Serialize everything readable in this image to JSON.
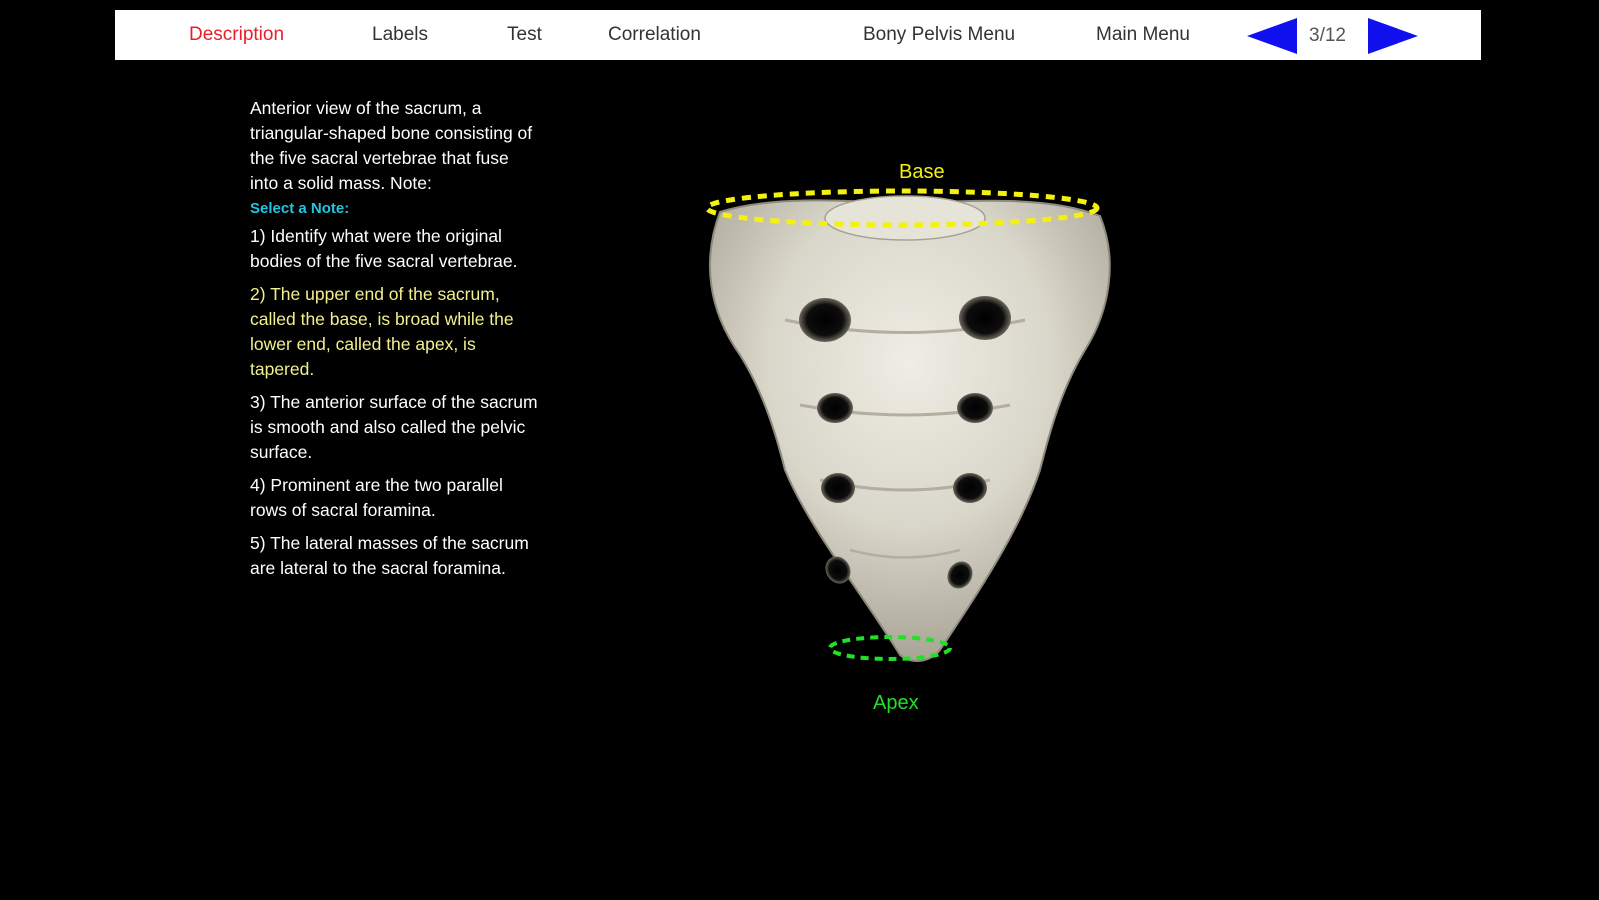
{
  "nav": {
    "items": [
      {
        "label": "Description",
        "active": true
      },
      {
        "label": "Labels"
      },
      {
        "label": "Test"
      },
      {
        "label": "Correlation"
      },
      {
        "label": "Bony Pelvis Menu"
      },
      {
        "label": "Main Menu"
      }
    ],
    "page_counter": "3/12",
    "prev_icon": "left-arrow-icon",
    "next_icon": "right-arrow-icon",
    "arrow_color": "#1010ee",
    "active_color": "#e8202a"
  },
  "description": {
    "intro": "Anterior view of the sacrum, a triangular-shaped bone consisting of the five sacral vertebrae that fuse into a solid mass. Note:",
    "select_prompt": "Select a Note:",
    "notes": [
      "1) Identify what were the original bodies of the five sacral vertebrae.",
      "2) The upper end of the sacrum, called the base, is broad while the lower end, called the apex, is tapered.",
      "3) The anterior surface of the sacrum is smooth and also called the pelvic surface.",
      "4) Prominent are the two parallel rows of sacral foramina.",
      "5) The lateral masses of the sacrum are lateral to the sacral foramina."
    ],
    "highlighted_note_index": 1,
    "highlight_color": "#f2f08c",
    "select_color": "#23c4e0"
  },
  "figure": {
    "labels": {
      "base": "Base",
      "apex": "Apex"
    },
    "base_color": "#f4f10f",
    "apex_color": "#22e02a"
  }
}
